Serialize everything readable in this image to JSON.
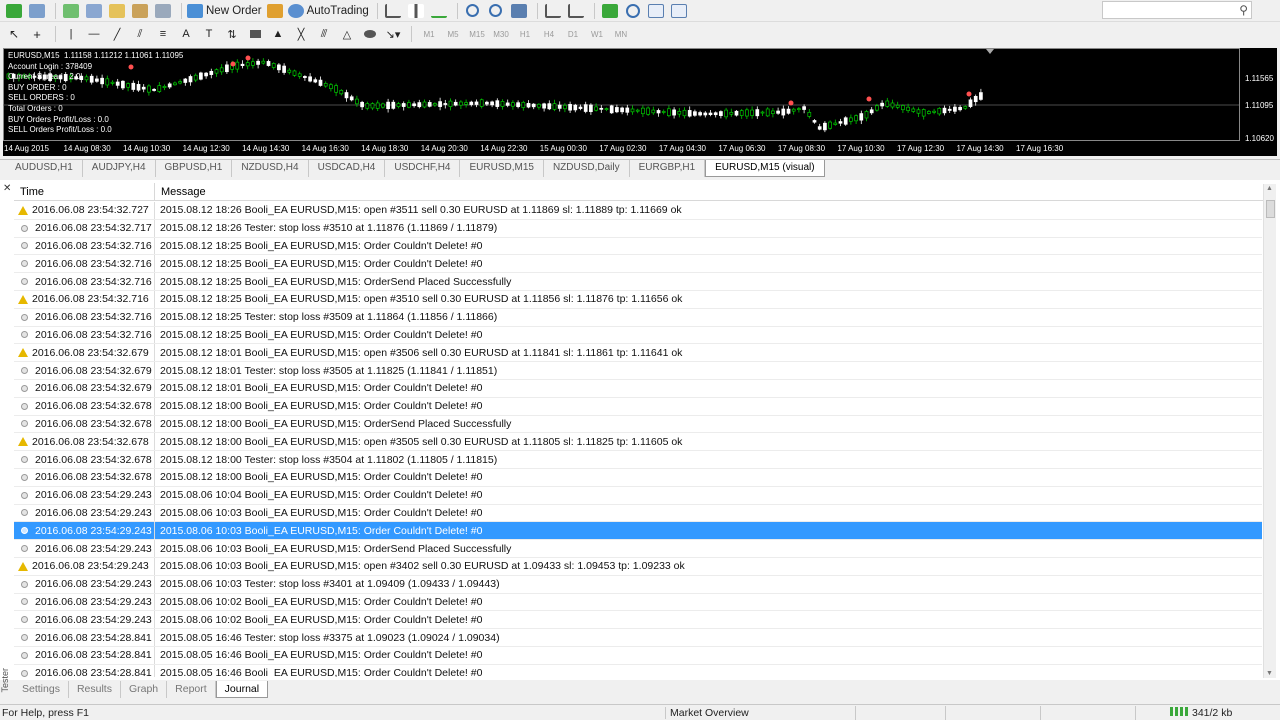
{
  "toolbar": {
    "new_order_label": "New Order",
    "autotrading_label": "AutoTrading",
    "timeframes": [
      "M1",
      "M5",
      "M15",
      "M30",
      "H1",
      "H4",
      "D1",
      "W1",
      "MN"
    ]
  },
  "chart": {
    "header": "EURUSD,M15  1.11158 1.11212 1.11061 1.11095",
    "info_lines": [
      "Account Login : 378409",
      "Current Spread : 2.0",
      "BUY ORDER : 0",
      "SELL ORDERS : 0",
      "Total Orders : 0",
      "BUY Orders Profit/Loss : 0.0",
      "SELL Orders Profit/Loss : 0.0"
    ],
    "price_labels": [
      "1.11565",
      "1.11095",
      "1.10620"
    ],
    "time_labels": [
      "14 Aug 2015",
      "14 Aug 08:30",
      "14 Aug 10:30",
      "14 Aug 12:30",
      "14 Aug 14:30",
      "14 Aug 16:30",
      "14 Aug 18:30",
      "14 Aug 20:30",
      "14 Aug 22:30",
      "15 Aug 00:30",
      "17 Aug 02:30",
      "17 Aug 04:30",
      "17 Aug 06:30",
      "17 Aug 08:30",
      "17 Aug 10:30",
      "17 Aug 12:30",
      "17 Aug 14:30",
      "17 Aug 16:30"
    ],
    "background_color": "#000000",
    "bull_color": "#00c800",
    "bear_color": "#ffffff"
  },
  "chart_tabs": [
    "AUDUSD,H1",
    "AUDJPY,H4",
    "GBPUSD,H1",
    "NZDUSD,H4",
    "USDCAD,H4",
    "USDCHF,H4",
    "EURUSD,M15",
    "NZDUSD,Daily",
    "EURGBP,H1",
    "EURUSD,M15 (visual)"
  ],
  "active_chart_tab": "EURUSD,M15 (visual)",
  "journal": {
    "columns": [
      "Time",
      "Message"
    ],
    "rows": [
      {
        "icon": "warning",
        "time": "2016.06.08 23:54:32.727",
        "message": "2015.08.12 18:26  Booli_EA EURUSD,M15: open #3511 sell 0.30 EURUSD at 1.11869 sl: 1.11889 tp: 1.11669 ok"
      },
      {
        "icon": "info",
        "time": "2016.06.08 23:54:32.717",
        "message": "2015.08.12 18:26  Tester: stop loss #3510 at 1.11876 (1.11869 / 1.11879)"
      },
      {
        "icon": "info",
        "time": "2016.06.08 23:54:32.716",
        "message": "2015.08.12 18:25  Booli_EA EURUSD,M15: Order Couldn't Delete! #0"
      },
      {
        "icon": "info",
        "time": "2016.06.08 23:54:32.716",
        "message": "2015.08.12 18:25  Booli_EA EURUSD,M15: Order Couldn't Delete! #0"
      },
      {
        "icon": "info",
        "time": "2016.06.08 23:54:32.716",
        "message": "2015.08.12 18:25  Booli_EA EURUSD,M15: OrderSend Placed Successfully"
      },
      {
        "icon": "warning",
        "time": "2016.06.08 23:54:32.716",
        "message": "2015.08.12 18:25  Booli_EA EURUSD,M15: open #3510 sell 0.30 EURUSD at 1.11856 sl: 1.11876 tp: 1.11656 ok"
      },
      {
        "icon": "info",
        "time": "2016.06.08 23:54:32.716",
        "message": "2015.08.12 18:25  Tester: stop loss #3509 at 1.11864 (1.11856 / 1.11866)"
      },
      {
        "icon": "info",
        "time": "2016.06.08 23:54:32.716",
        "message": "2015.08.12 18:25  Booli_EA EURUSD,M15: Order Couldn't Delete! #0"
      },
      {
        "icon": "warning",
        "time": "2016.06.08 23:54:32.679",
        "message": "2015.08.12 18:01  Booli_EA EURUSD,M15: open #3506 sell 0.30 EURUSD at 1.11841 sl: 1.11861 tp: 1.11641 ok"
      },
      {
        "icon": "info",
        "time": "2016.06.08 23:54:32.679",
        "message": "2015.08.12 18:01  Tester: stop loss #3505 at 1.11825 (1.11841 / 1.11851)"
      },
      {
        "icon": "info",
        "time": "2016.06.08 23:54:32.679",
        "message": "2015.08.12 18:01  Booli_EA EURUSD,M15: Order Couldn't Delete! #0"
      },
      {
        "icon": "info",
        "time": "2016.06.08 23:54:32.678",
        "message": "2015.08.12 18:00  Booli_EA EURUSD,M15: Order Couldn't Delete! #0"
      },
      {
        "icon": "info",
        "time": "2016.06.08 23:54:32.678",
        "message": "2015.08.12 18:00  Booli_EA EURUSD,M15: OrderSend Placed Successfully"
      },
      {
        "icon": "warning",
        "time": "2016.06.08 23:54:32.678",
        "message": "2015.08.12 18:00  Booli_EA EURUSD,M15: open #3505 sell 0.30 EURUSD at 1.11805 sl: 1.11825 tp: 1.11605 ok"
      },
      {
        "icon": "info",
        "time": "2016.06.08 23:54:32.678",
        "message": "2015.08.12 18:00  Tester: stop loss #3504 at 1.11802 (1.11805 / 1.11815)"
      },
      {
        "icon": "info",
        "time": "2016.06.08 23:54:32.678",
        "message": "2015.08.12 18:00  Booli_EA EURUSD,M15: Order Couldn't Delete! #0"
      },
      {
        "icon": "info",
        "time": "2016.06.08 23:54:29.243",
        "message": "2015.08.06 10:04  Booli_EA EURUSD,M15: Order Couldn't Delete! #0"
      },
      {
        "icon": "info",
        "time": "2016.06.08 23:54:29.243",
        "message": "2015.08.06 10:03  Booli_EA EURUSD,M15: Order Couldn't Delete! #0"
      },
      {
        "icon": "info",
        "time": "2016.06.08 23:54:29.243",
        "message": "2015.08.06 10:03  Booli_EA EURUSD,M15: Order Couldn't Delete! #0",
        "selected": true
      },
      {
        "icon": "info",
        "time": "2016.06.08 23:54:29.243",
        "message": "2015.08.06 10:03  Booli_EA EURUSD,M15: OrderSend Placed Successfully"
      },
      {
        "icon": "warning",
        "time": "2016.06.08 23:54:29.243",
        "message": "2015.08.06 10:03  Booli_EA EURUSD,M15: open #3402 sell 0.30 EURUSD at 1.09433 sl: 1.09453 tp: 1.09233 ok"
      },
      {
        "icon": "info",
        "time": "2016.06.08 23:54:29.243",
        "message": "2015.08.06 10:03  Tester: stop loss #3401 at 1.09409 (1.09433 / 1.09443)"
      },
      {
        "icon": "info",
        "time": "2016.06.08 23:54:29.243",
        "message": "2015.08.06 10:02  Booli_EA EURUSD,M15: Order Couldn't Delete! #0"
      },
      {
        "icon": "info",
        "time": "2016.06.08 23:54:29.243",
        "message": "2015.08.06 10:02  Booli_EA EURUSD,M15: Order Couldn't Delete! #0"
      },
      {
        "icon": "info",
        "time": "2016.06.08 23:54:28.841",
        "message": "2015.08.05 16:46  Tester: stop loss #3375 at 1.09023 (1.09024 / 1.09034)"
      },
      {
        "icon": "info",
        "time": "2016.06.08 23:54:28.841",
        "message": "2015.08.05 16:46  Booli_EA EURUSD,M15: Order Couldn't Delete! #0"
      },
      {
        "icon": "info",
        "time": "2016.06.08 23:54:28.841",
        "message": "2015.08.05 16:46  Booli_EA EURUSD,M15: Order Couldn't Delete! #0"
      }
    ],
    "selected_color": "#3399ff"
  },
  "side_label": "Tester",
  "bottom_tabs": [
    "Settings",
    "Results",
    "Graph",
    "Report",
    "Journal"
  ],
  "active_bottom_tab": "Journal",
  "status": {
    "help": "For Help, press F1",
    "profile": "Market Overview",
    "traffic": "341/2 kb"
  }
}
